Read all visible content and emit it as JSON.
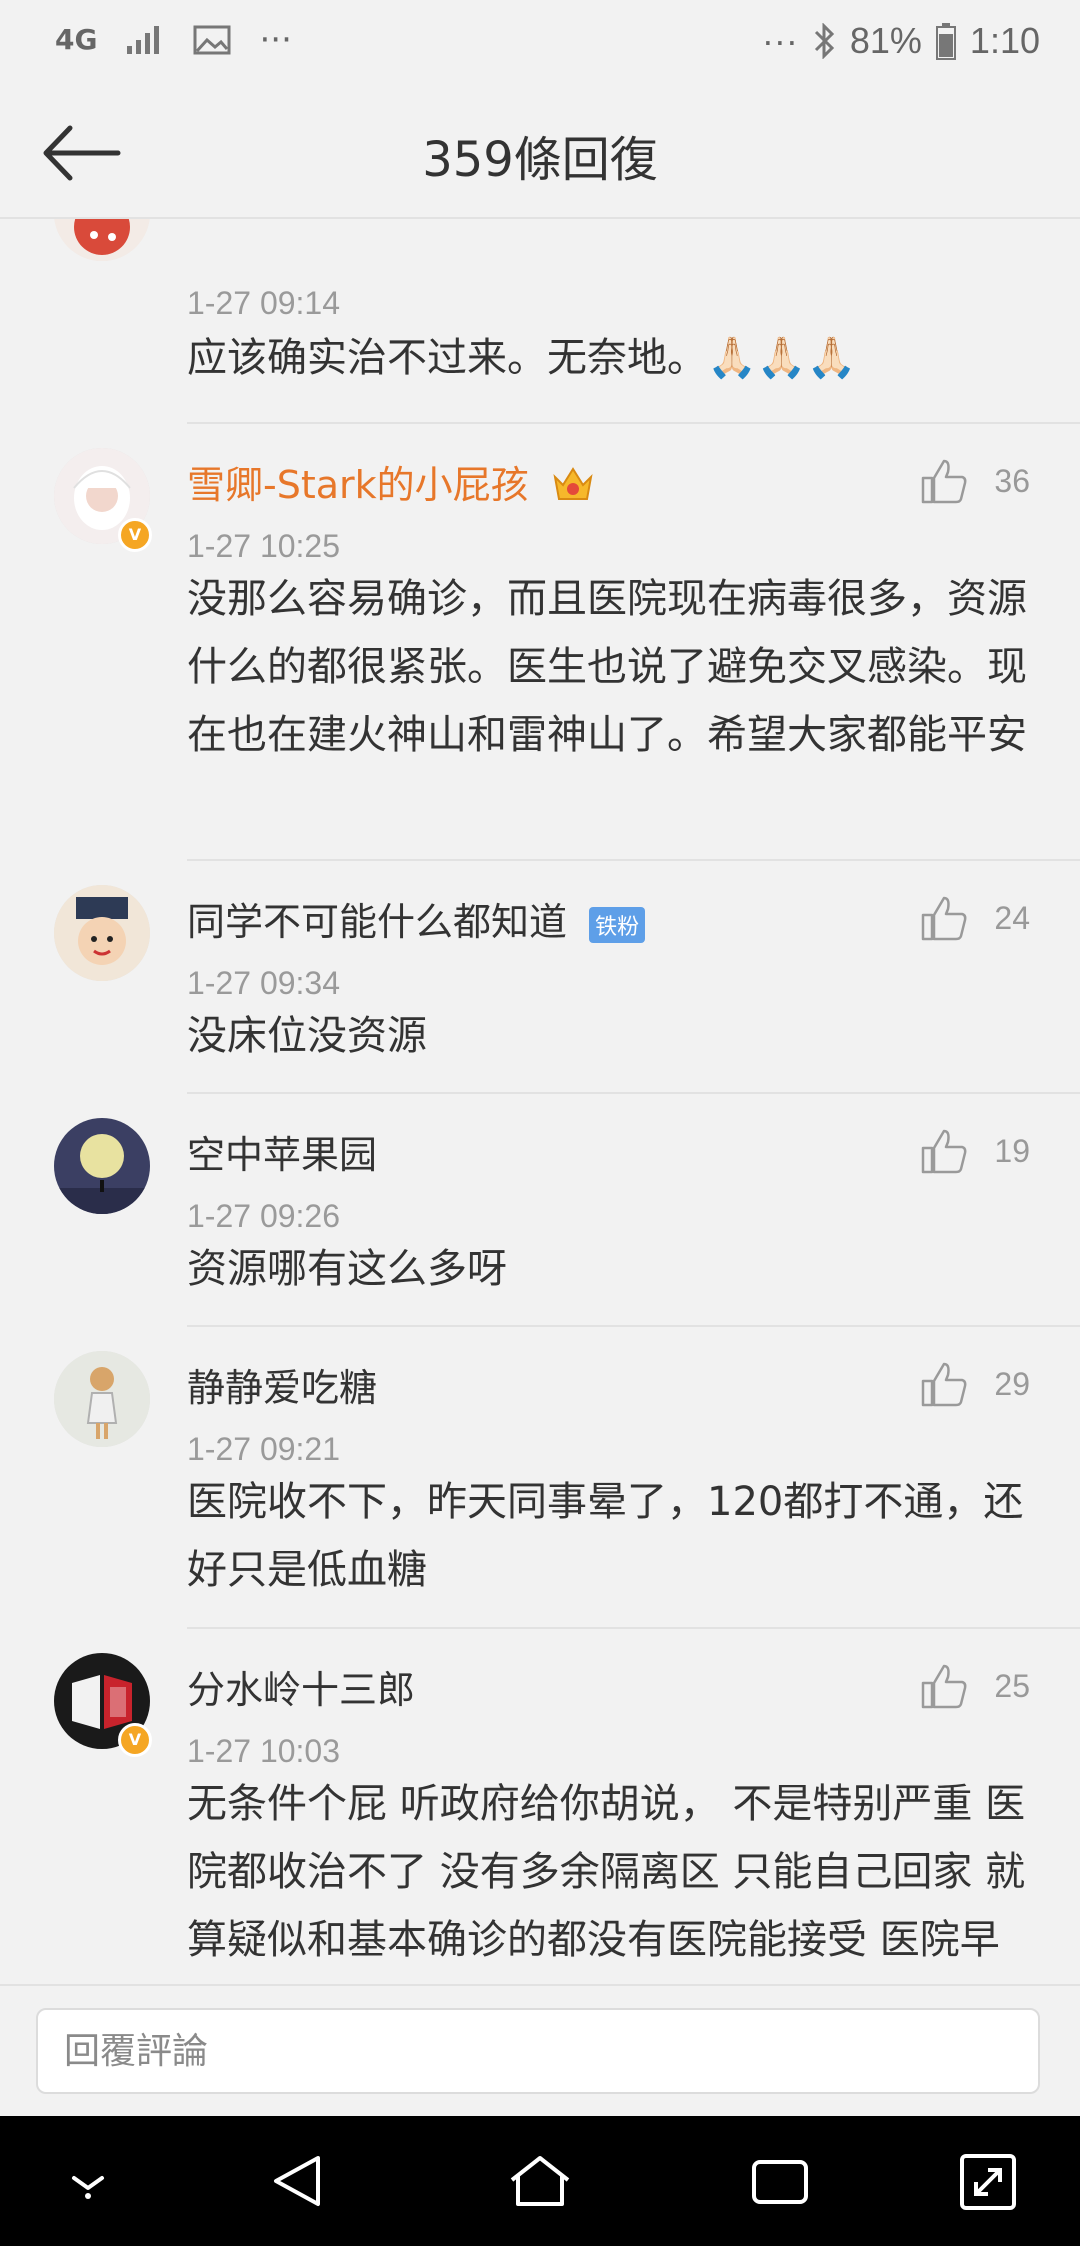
{
  "status_bar": {
    "network": "4G",
    "more": "···",
    "battery_percent": "81%",
    "time": "1:10"
  },
  "header": {
    "title": "359條回復"
  },
  "comments": [
    {
      "timestamp": "1-27 09:14",
      "content": "应该确实治不过来。无奈地。🙏🏻🙏🏻🙏🏻"
    },
    {
      "username": "雪卿-Stark的小屁孩",
      "verified": true,
      "likes": "36",
      "timestamp": "1-27 10:25",
      "content": "没那么容易确诊，而且医院现在病毒很多，资源什么的都很紧张。医生也说了避免交叉感染。现在也在建火神山和雷神山了。希望大家都能平安"
    },
    {
      "username": "同学不可能什么都知道",
      "badge": "铁粉",
      "likes": "24",
      "timestamp": "1-27 09:34",
      "content": "没床位没资源"
    },
    {
      "username": "空中苹果园",
      "likes": "19",
      "timestamp": "1-27 09:26",
      "content": "资源哪有这么多呀"
    },
    {
      "username": "静静爱吃糖",
      "likes": "29",
      "timestamp": "1-27 09:21",
      "content": "医院收不下，昨天同事晕了，120都打不通，还好只是低血糖"
    },
    {
      "username": "分水岭十三郎",
      "verified": true,
      "likes": "25",
      "timestamp": "1-27 10:03",
      "content": "无条件个屁 听政府给你胡说， 不是特别严重 医院都收治不了 没有多余隔离区 只能自己回家 就算疑似和基本确诊的都没有医院能接受 医院早都已经饱和了"
    }
  ],
  "reply_input": {
    "placeholder": "回覆評論"
  },
  "colors": {
    "gold_username": "#e7772a",
    "badge_blue": "#5e9fe8",
    "verified_orange": "#f5a623"
  }
}
